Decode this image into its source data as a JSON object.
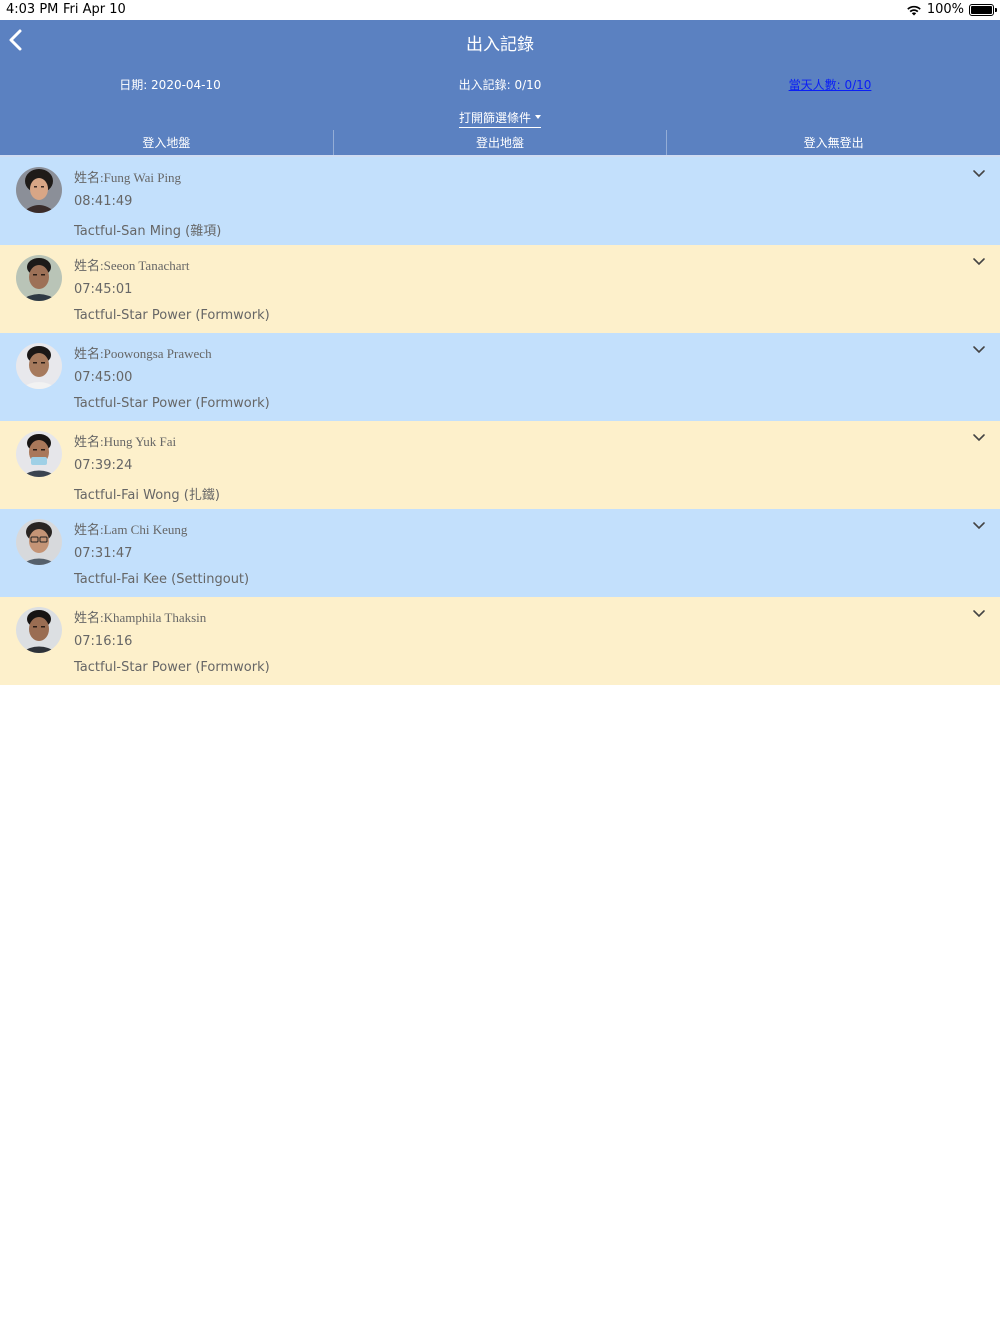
{
  "status_bar": {
    "time": "4:03 PM",
    "date": "Fri Apr 10",
    "battery": "100%",
    "wifi_icon": "wifi-icon",
    "battery_icon": "battery-full-icon"
  },
  "header": {
    "back_icon": "chevron-left-icon",
    "title": "出入記錄",
    "date_label": "日期: 2020-04-10",
    "records_label": "出入記錄: 0/10",
    "count_label": "當天人數: 0/10",
    "filter_label": "打開篩選條件",
    "filter_icon": "caret-down-icon"
  },
  "tabs": [
    {
      "label": "登入地盤",
      "active": true
    },
    {
      "label": "登出地盤",
      "active": false
    },
    {
      "label": "登入無登出",
      "active": false
    }
  ],
  "records": [
    {
      "name": "姓名:Fung Wai Ping",
      "time": "08:41:49",
      "company": "Tactful-San Ming (雜項)",
      "color": "#c3e0fc"
    },
    {
      "name": "姓名:Seeon Tanachart",
      "time": "07:45:01",
      "company": "Tactful-Star Power (Formwork)",
      "color": "#fdf0cb"
    },
    {
      "name": "姓名:Poowongsa Prawech",
      "time": "07:45:00",
      "company": "Tactful-Star Power (Formwork)",
      "color": "#c3e0fc"
    },
    {
      "name": "姓名:Hung Yuk Fai",
      "time": "07:39:24",
      "company": "Tactful-Fai Wong (扎鐵)",
      "color": "#fdf0cb"
    },
    {
      "name": "姓名:Lam Chi Keung",
      "time": "07:31:47",
      "company": "Tactful-Fai Kee (Settingout)",
      "color": "#c3e0fc"
    },
    {
      "name": "姓名:Khamphila Thaksin",
      "time": "07:16:16",
      "company": "Tactful-Star Power (Formwork)",
      "color": "#fdf0cb"
    }
  ],
  "colors": {
    "header_bg": "#5b81c1",
    "row_blue": "#c3e0fc",
    "row_yellow": "#fdf0cb",
    "link_blue": "#0b1ff5"
  }
}
